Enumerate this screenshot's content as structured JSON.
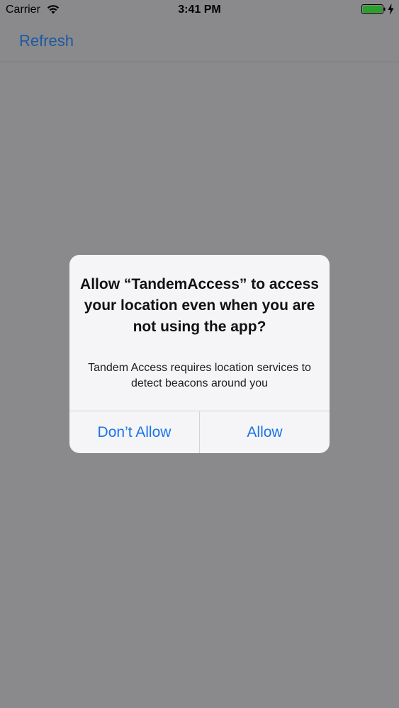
{
  "status_bar": {
    "carrier": "Carrier",
    "time": "3:41 PM",
    "icons": [
      "wifi-icon",
      "battery-icon",
      "charging-icon"
    ]
  },
  "nav_bar": {
    "refresh_label": "Refresh"
  },
  "alert": {
    "title": "Allow “TandemAccess” to access your location even when you are not using the app?",
    "message": "Tandem Access requires location services to detect beacons around you",
    "dont_allow_label": "Don’t Allow",
    "allow_label": "Allow"
  },
  "colors": {
    "background_dimmed": "#8a898b",
    "accent_blue": "#1a74e8",
    "nav_blue_dimmed": "#1c5aa4",
    "alert_background": "#f5f5f7",
    "battery_green": "#2ca02c"
  }
}
